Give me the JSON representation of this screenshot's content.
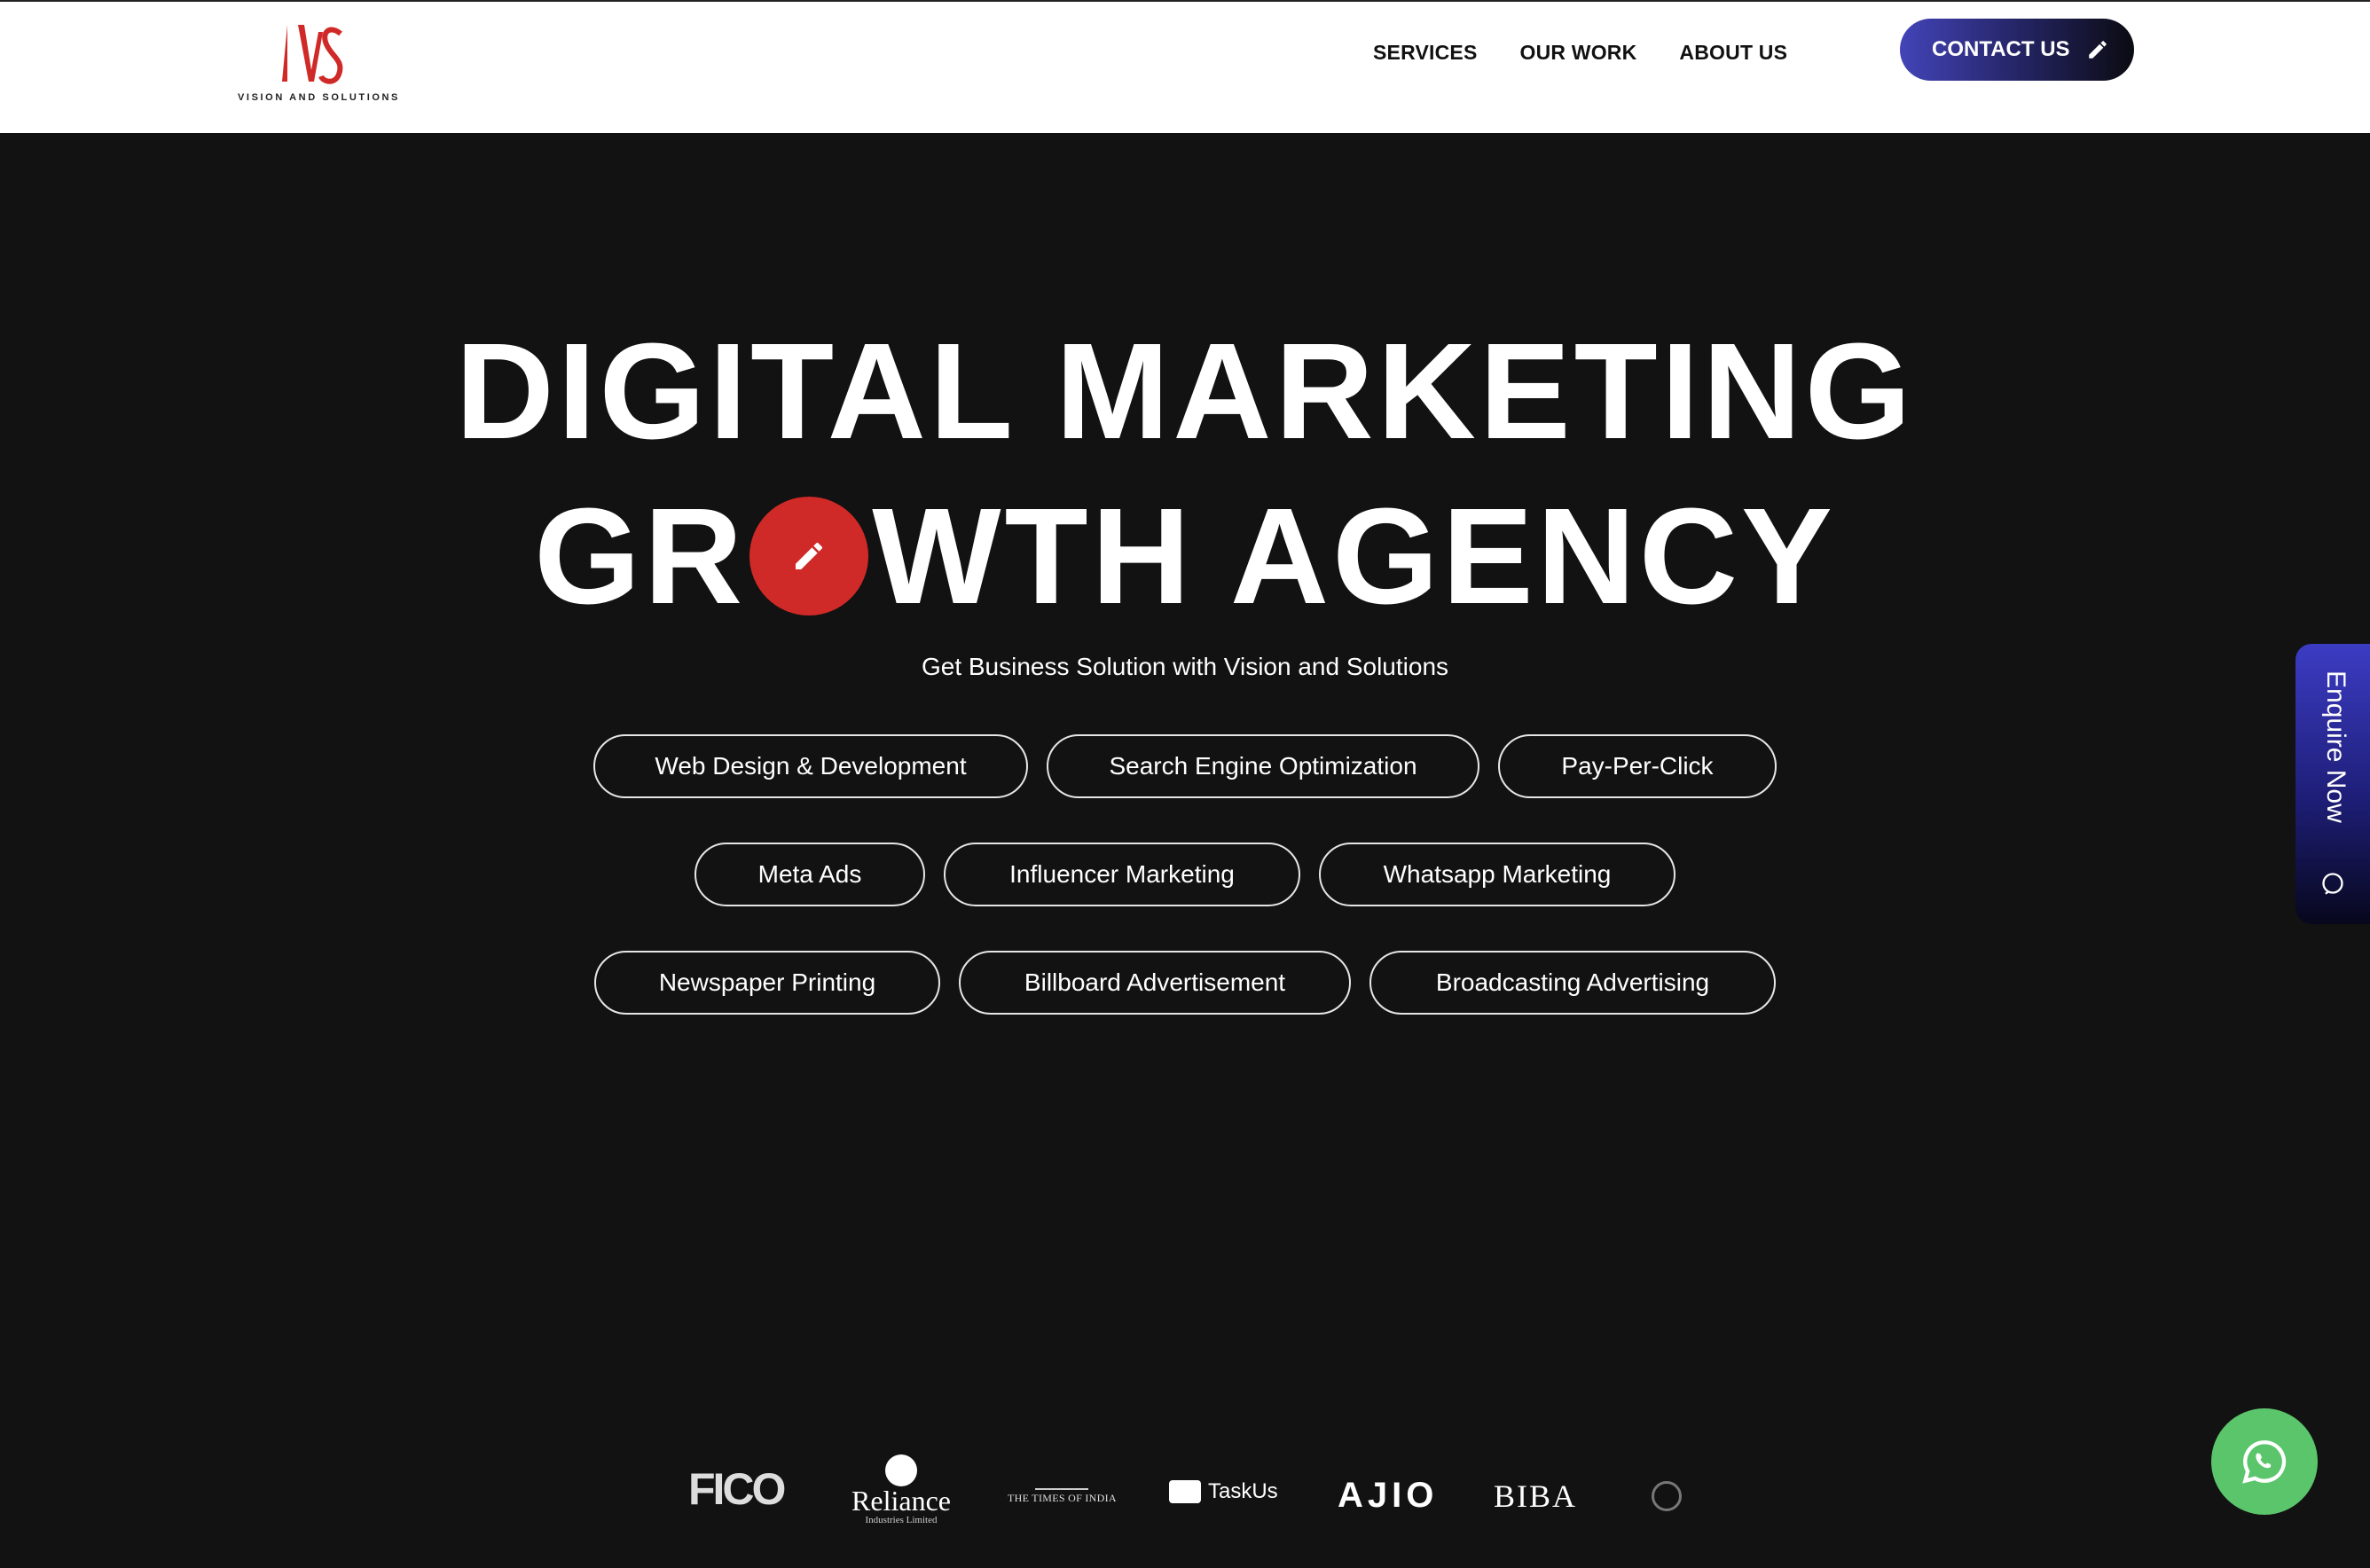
{
  "header": {
    "logo": {
      "mark_text": "VAS",
      "tagline": "VISION AND SOLUTIONS"
    },
    "nav": [
      "SERVICES",
      "OUR WORK",
      "ABOUT US"
    ],
    "contact_label": "CONTACT US"
  },
  "hero": {
    "title_line1": "DIGITAL MARKETING",
    "title_line2_a": "GR",
    "title_line2_b": "WTH AGENCY",
    "subtitle": "Get Business Solution with Vision and Solutions",
    "services_row1": [
      "Web Design & Development",
      "Search Engine Optimization",
      "Pay-Per-Click"
    ],
    "services_row2": [
      "Meta Ads",
      "Influencer Marketing",
      "Whatsapp Marketing"
    ],
    "services_row3": [
      "Newspaper Printing",
      "Billboard Advertisement",
      "Broadcasting Advertising"
    ]
  },
  "enquire": {
    "label": "Enquire Now"
  },
  "clients": {
    "fico": "FICO",
    "reliance_name": "Reliance",
    "reliance_sub": "Industries Limited",
    "toi": "THE TIMES OF INDIA",
    "taskus": "TaskUs",
    "ajio": "AJIO",
    "biba": "BIBA"
  },
  "colors": {
    "brand_red": "#cf2a27",
    "hero_bg": "#121212",
    "accent_blue": "#4344b8",
    "whatsapp_green": "#5bc56c"
  }
}
